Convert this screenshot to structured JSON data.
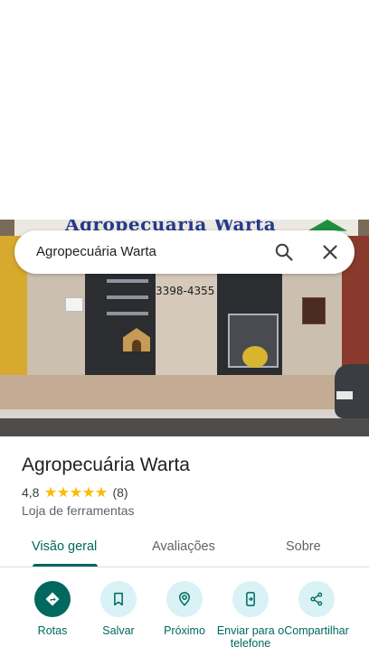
{
  "photo": {
    "sign_text": "Agropecuária Warta",
    "phone_text": "3398-4355"
  },
  "search": {
    "value": "Agropecuária Warta",
    "search_icon": "search-icon",
    "close_icon": "close-icon"
  },
  "place": {
    "title": "Agropecuária Warta",
    "rating": "4,8",
    "stars": 5,
    "review_count": "(8)",
    "category": "Loja de ferramentas"
  },
  "tabs": [
    {
      "label": "Visão geral",
      "active": true
    },
    {
      "label": "Avaliações",
      "active": false
    },
    {
      "label": "Sobre",
      "active": false
    }
  ],
  "actions": [
    {
      "label": "Rotas",
      "icon": "directions-icon"
    },
    {
      "label": "Salvar",
      "icon": "bookmark-icon"
    },
    {
      "label": "Próximo",
      "icon": "nearby-icon"
    },
    {
      "label": "Enviar para o telefone",
      "icon": "send-to-phone-icon"
    },
    {
      "label": "Compartilhar",
      "icon": "share-icon"
    }
  ],
  "colors": {
    "accent": "#00685e",
    "action_bg": "#d8f2f6",
    "star": "#fbbc04"
  }
}
